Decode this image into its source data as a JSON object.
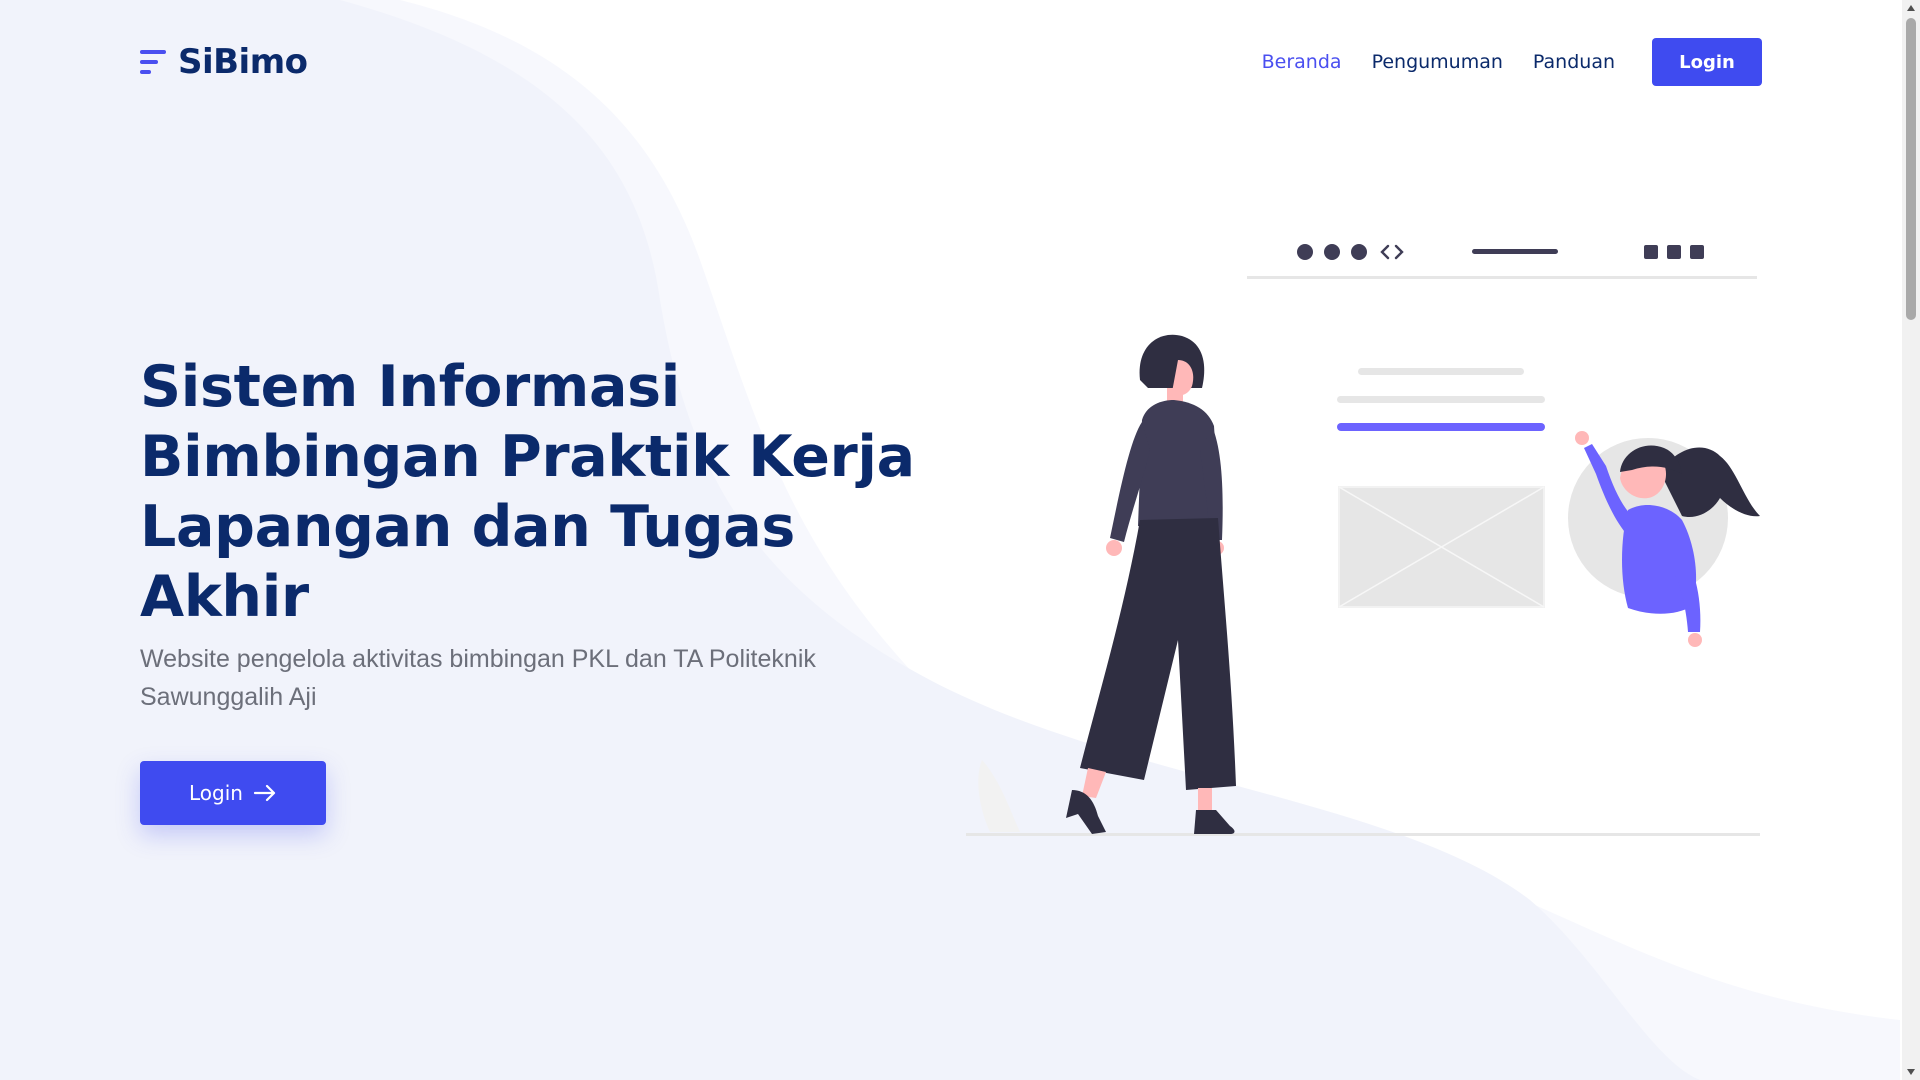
{
  "brand": {
    "name": "SiBimo",
    "accent": "#4a4ff0",
    "dark": "#0b2a6b"
  },
  "nav": {
    "items": [
      {
        "label": "Beranda",
        "active": true
      },
      {
        "label": "Pengumuman",
        "active": false
      },
      {
        "label": "Panduan",
        "active": false
      }
    ],
    "login_label": "Login"
  },
  "hero": {
    "title": "Sistem Informasi Bimbingan Praktik Kerja Lapangan dan Tugas Akhir",
    "subtitle": "Website pengelola aktivitas bimbingan PKL dan TA Politeknik Sawunggalih Aji",
    "button_label": "Login",
    "button_icon": "arrow-right-icon"
  },
  "illustration": {
    "description_icon": "web-design-people-illustration"
  }
}
